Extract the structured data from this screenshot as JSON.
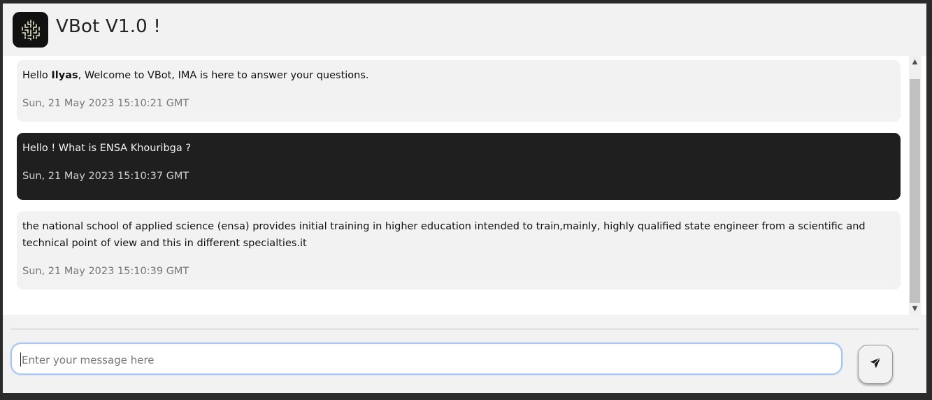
{
  "header": {
    "title": "VBot V1.0 !",
    "logo_icon": "maze-logo-icon"
  },
  "messages": [
    {
      "sender": "bot",
      "greeting": "Hello ",
      "name": "Ilyas",
      "text": ", Welcome to VBot, IMA is here to answer your questions.",
      "timestamp": "Sun, 21 May 2023 15:10:21 GMT"
    },
    {
      "sender": "user",
      "text": "Hello ! What is ENSA Khouribga ?",
      "timestamp": "Sun, 21 May 2023 15:10:37 GMT"
    },
    {
      "sender": "bot",
      "text": "the national school of applied science (ensa) provides initial training in higher education intended to train,mainly, highly qualified state engineer from a scientific and technical point of view and this in different specialties.it",
      "timestamp": "Sun, 21 May 2023 15:10:39 GMT"
    }
  ],
  "composer": {
    "placeholder": "Enter your message here",
    "value": "",
    "send_icon": "paper-plane-icon"
  },
  "colors": {
    "bot_bubble": "#f2f2f2",
    "user_bubble": "#1f1f1f",
    "input_focus": "#a8c7f0"
  }
}
